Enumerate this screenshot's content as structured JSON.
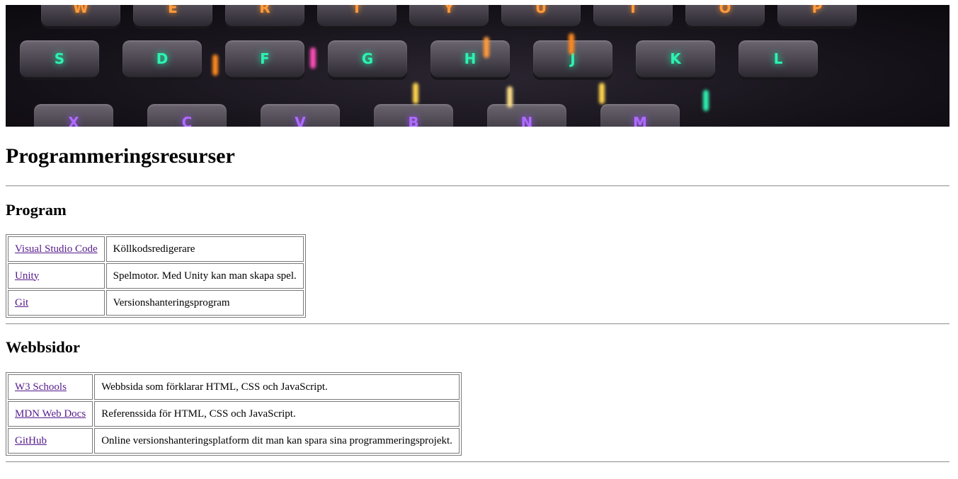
{
  "page_title": "Programmeringsresurser",
  "banner": {
    "row1_keys": [
      "W",
      "E",
      "R",
      "T",
      "Y",
      "U",
      "I",
      "O",
      "P"
    ],
    "row2_keys": [
      "S",
      "D",
      "F",
      "G",
      "H",
      "J",
      "K",
      "L"
    ],
    "row3_keys": [
      "X",
      "C",
      "V",
      "B",
      "N",
      "M"
    ]
  },
  "sections": [
    {
      "heading": "Program",
      "rows": [
        {
          "link": "Visual Studio Code",
          "description": "Köllkodsredigerare"
        },
        {
          "link": "Unity",
          "description": "Spelmotor. Med Unity kan man skapa spel."
        },
        {
          "link": "Git",
          "description": "Versionshanteringsprogram"
        }
      ]
    },
    {
      "heading": "Webbsidor",
      "rows": [
        {
          "link": "W3 Schools",
          "description": "Webbsida som förklarar HTML, CSS och JavaScript."
        },
        {
          "link": "MDN Web Docs",
          "description": "Referenssida för HTML, CSS och JavaScript."
        },
        {
          "link": "GitHub",
          "description": "Online versionshanteringsplatform dit man kan spara sina programmeringsprojekt."
        }
      ]
    }
  ],
  "colors": {
    "link_visited": "#551a8b",
    "key_orange": "#ff9b3a",
    "key_green": "#2ef2b0",
    "key_purple": "#b06bff"
  }
}
